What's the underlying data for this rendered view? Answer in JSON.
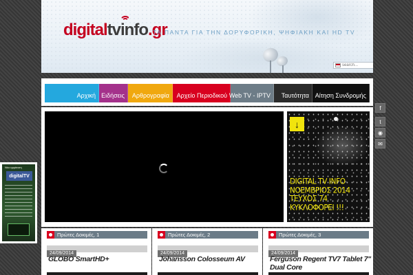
{
  "header": {
    "logo_part_a": "digital",
    "logo_part_b": "tvinfo",
    "logo_part_c": ".gr",
    "tagline": "ΤΑ ΠΑΝΤΑ ΓΙΑ ΤΗΝ ΔΟΡΥΦΟΡΙΚΗ, ΨΗΦΙΑΚΗ ΚΑΙ HD TV",
    "search_placeholder": "search..."
  },
  "nav": {
    "items": [
      {
        "label": "Αρχική",
        "color": "#24a8de"
      },
      {
        "label": "Ειδήσεις",
        "color": "#a4318b"
      },
      {
        "label": "Αρθρογραφία",
        "color": "#f0a80f"
      },
      {
        "label": "Αρχείο Περιοδικού",
        "color": "#d8001f"
      },
      {
        "label": "Web TV - IPTV",
        "color": "#6d7c87"
      },
      {
        "label": "Ταυτότητα",
        "color": "#2b2b2b"
      },
      {
        "label": "Αίτηση Συνδρομής",
        "color": "#101010"
      }
    ]
  },
  "social": {
    "icons": [
      "facebook-icon",
      "twitter-icon",
      "rss-icon",
      "email-icon"
    ],
    "glyphs": [
      "f",
      "t",
      "◉",
      "✉"
    ]
  },
  "promo": {
    "arrow": "↓",
    "line1": "DIGITAL TV INFO",
    "line2": "ΝΟΕΜΒΡΙΟΣ 2014",
    "line3": "ΤΕΥΧΟΣ 74",
    "line4": "ΚΥΚΛΟΦΟΡΕΙ !!!"
  },
  "left_ad": {
    "top_text": "Νέα εμφάνιση",
    "brand": "TV",
    "title": "digitalTV"
  },
  "posts": [
    {
      "category": "Πρώτες Δοκιμές, 1",
      "date": "24/09/2014",
      "title": "GLOBO SmartHD+"
    },
    {
      "category": "Πρώτες Δοκιμές, 2",
      "date": "24/09/2014",
      "title": "Johansson Colosseum AV"
    },
    {
      "category": "Πρώτες Δοκιμές, 3",
      "date": "24/09/2014",
      "title": "Ferguson Regent TV7 Tablet 7'' Dual Core"
    }
  ],
  "colors": {
    "brand_red": "#c4001f",
    "promo_yellow": "#f1e40d"
  }
}
